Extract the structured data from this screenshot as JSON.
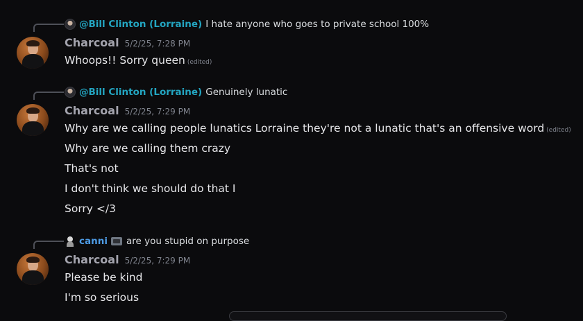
{
  "messages": [
    {
      "reply": {
        "user": "@Bill Clinton (Lorraine)",
        "text": "I hate anyone who goes to private school 100%"
      },
      "author": "Charcoal",
      "timestamp": "5/2/25, 7:28 PM",
      "lines": [
        {
          "text": "Whoops!! Sorry queen",
          "edited": "(edited)"
        }
      ]
    },
    {
      "reply": {
        "user": "@Bill Clinton (Lorraine)",
        "text": "Genuinely lunatic"
      },
      "author": "Charcoal",
      "timestamp": "5/2/25, 7:29 PM",
      "lines": [
        {
          "text": "Why are we calling people lunatics Lorraine they're not a lunatic that's an offensive word",
          "edited": "(edited)"
        },
        {
          "text": "Why are we calling them crazy"
        },
        {
          "text": "That's not"
        },
        {
          "text": "I don't think we should do that I"
        },
        {
          "text": "Sorry </3"
        }
      ]
    },
    {
      "reply": {
        "user": "canni",
        "text": "are you stupid on purpose"
      },
      "author": "Charcoal",
      "timestamp": "5/2/25, 7:29 PM",
      "lines": [
        {
          "text": "Please be kind"
        },
        {
          "text": "I'm so serious"
        }
      ]
    }
  ],
  "colors": {
    "background": "#0b0b0d",
    "reply_mention": "#23a5c1",
    "reply_user_blue": "#4d9be5",
    "author": "#a3a3ad",
    "timestamp": "#80848e"
  },
  "icons": [
    "avatar-icon",
    "reply-avatar-icon",
    "server-tag-icon"
  ]
}
